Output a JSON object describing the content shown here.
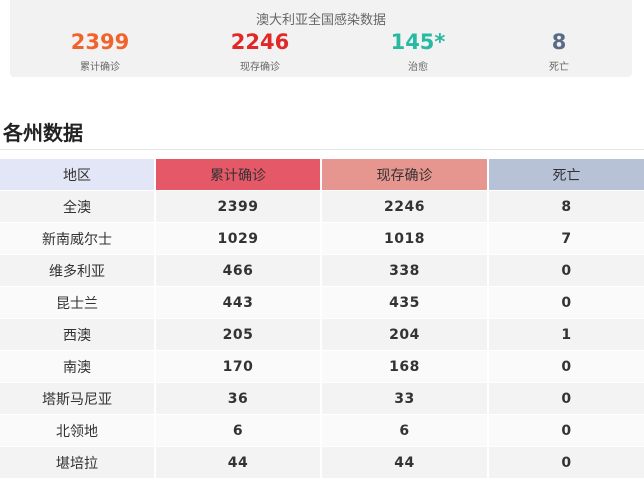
{
  "summary": {
    "title": "澳大利亚全国感染数据",
    "stats": [
      {
        "value": "2399",
        "label": "累计确诊",
        "color": "#f0642c"
      },
      {
        "value": "2246",
        "label": "现存确诊",
        "color": "#e02828"
      },
      {
        "value": "145*",
        "label": "治愈",
        "color": "#27b9a2"
      },
      {
        "value": "8",
        "label": "死亡",
        "color": "#5a6b86"
      }
    ]
  },
  "section": {
    "title": "各州数据"
  },
  "table": {
    "headers": [
      "地区",
      "累计确诊",
      "现存确诊",
      "死亡"
    ],
    "header_colors": [
      "#e2e6f6",
      "#e55868",
      "#e6958f",
      "#b8c2d6"
    ],
    "rows": [
      [
        "全澳",
        "2399",
        "2246",
        "8"
      ],
      [
        "新南威尔士",
        "1029",
        "1018",
        "7"
      ],
      [
        "维多利亚",
        "466",
        "338",
        "0"
      ],
      [
        "昆士兰",
        "443",
        "435",
        "0"
      ],
      [
        "西澳",
        "205",
        "204",
        "1"
      ],
      [
        "南澳",
        "170",
        "168",
        "0"
      ],
      [
        "塔斯马尼亚",
        "36",
        "33",
        "0"
      ],
      [
        "北领地",
        "6",
        "6",
        "0"
      ],
      [
        "堪培拉",
        "44",
        "44",
        "0"
      ]
    ]
  }
}
